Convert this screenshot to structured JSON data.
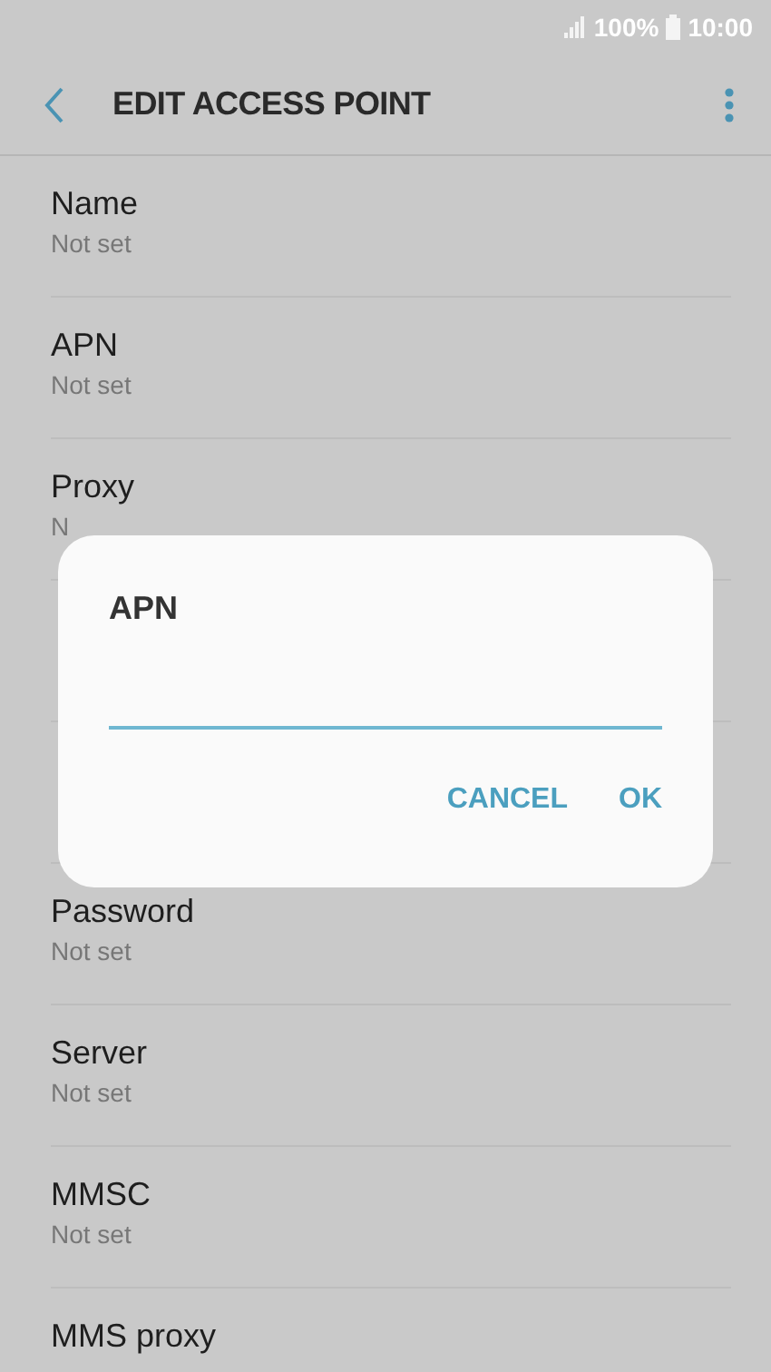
{
  "status_bar": {
    "battery": "100%",
    "time": "10:00"
  },
  "header": {
    "title": "EDIT ACCESS POINT"
  },
  "settings": [
    {
      "kind": "setting",
      "title": "Name",
      "subtitle": "Not set"
    },
    {
      "kind": "setting",
      "title": "APN",
      "subtitle": "Not set"
    },
    {
      "kind": "setting",
      "title": "Proxy",
      "subtitle": "N"
    },
    {
      "kind": "covered"
    },
    {
      "kind": "covered"
    },
    {
      "kind": "setting",
      "title": "Password",
      "subtitle": "Not set"
    },
    {
      "kind": "setting",
      "title": "Server",
      "subtitle": "Not set"
    },
    {
      "kind": "setting",
      "title": "MMSC",
      "subtitle": "Not set"
    },
    {
      "kind": "setting",
      "title": "MMS proxy"
    }
  ],
  "dialog": {
    "title": "APN",
    "buttons": [
      "CANCEL",
      "OK"
    ]
  }
}
